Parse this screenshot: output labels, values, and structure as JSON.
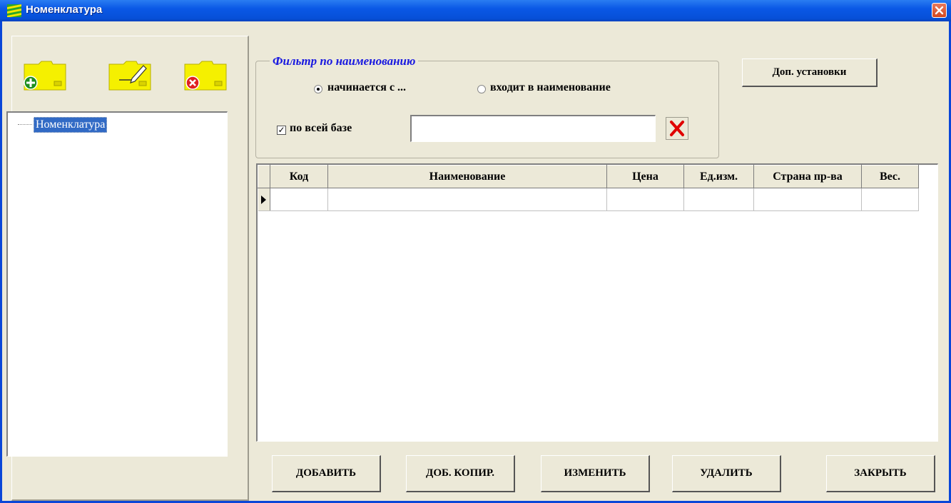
{
  "window": {
    "title": "Номенклатура"
  },
  "tree": {
    "root_label": "Номенклатура"
  },
  "filter": {
    "legend": "Фильтр по наименованию",
    "radio_starts": "начинается с ...",
    "radio_contains": "входит в наименование",
    "radio_selected": "starts",
    "checkbox_all_label": "по всей базе",
    "checkbox_all_checked": true,
    "search_value": ""
  },
  "buttons": {
    "extra_settings": "Доп. установки",
    "add": "ДОБАВИТЬ",
    "add_copy": "ДОБ. КОПИР.",
    "edit": "ИЗМЕНИТЬ",
    "delete": "УДАЛИТЬ",
    "close": "ЗАКРЫТЬ"
  },
  "grid": {
    "columns": [
      "Код",
      "Наименование",
      "Цена",
      "Ед.изм.",
      "Страна пр-ва",
      "Вес."
    ],
    "rows": [
      [
        "",
        "",
        "",
        "",
        "",
        ""
      ]
    ]
  },
  "icons": {
    "app": "app-logo-icon",
    "add_folder": "folder-add-icon",
    "edit_folder": "folder-edit-icon",
    "delete_folder": "folder-delete-icon",
    "clear": "clear-x-icon",
    "close": "close-icon"
  },
  "colors": {
    "titlebar": "#0a58e6",
    "selection": "#316ac5",
    "legend": "#1818e0",
    "folder": "#f5f000"
  }
}
